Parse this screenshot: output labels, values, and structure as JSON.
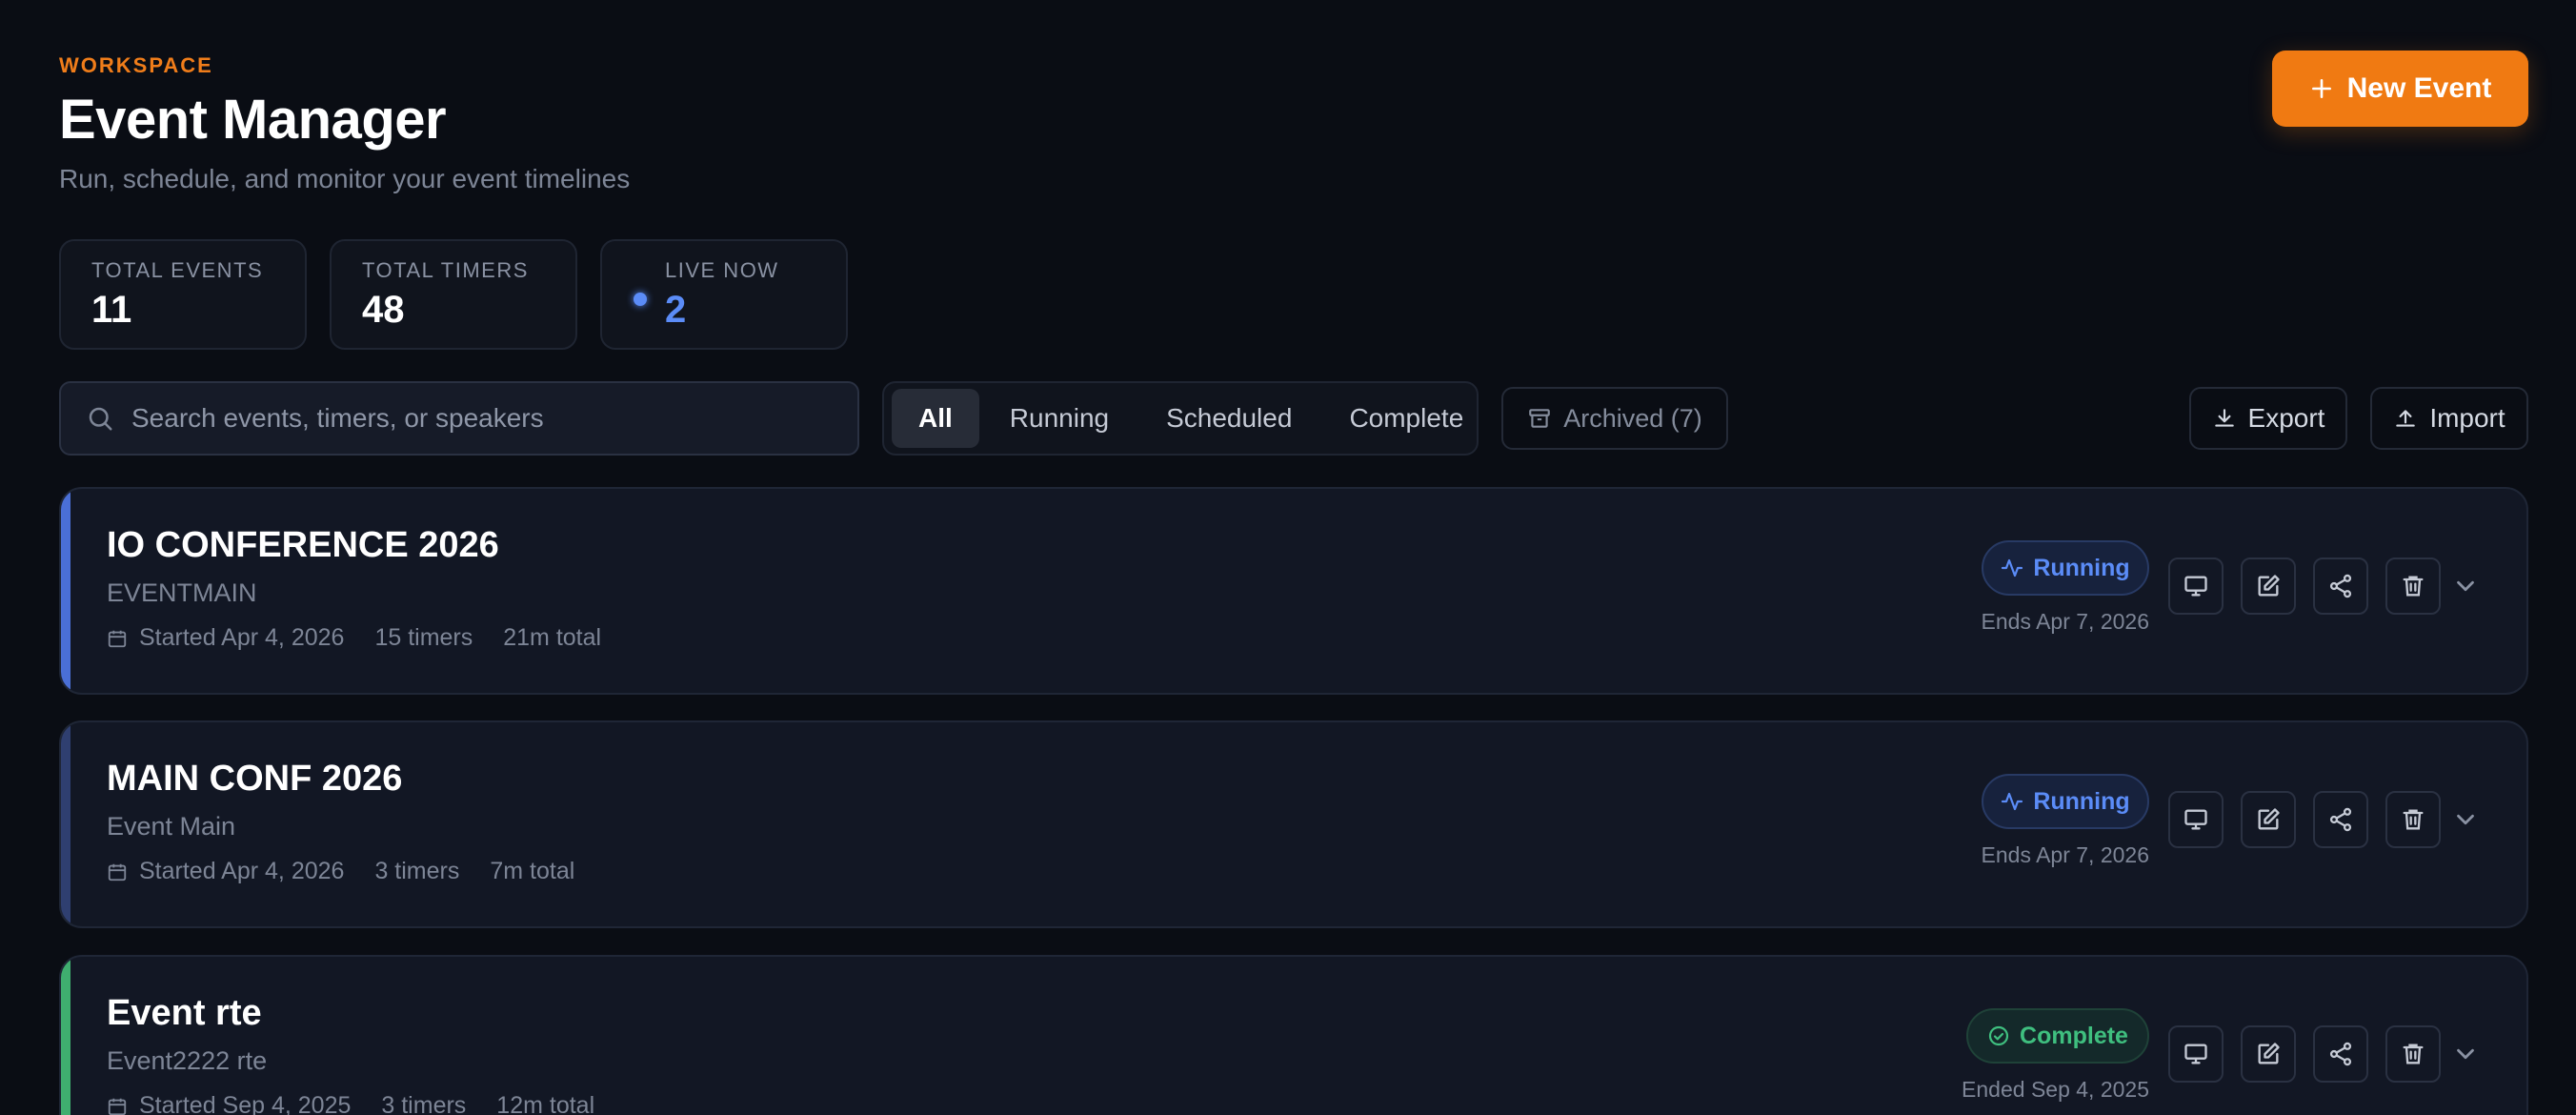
{
  "header": {
    "eyebrow": "WORKSPACE",
    "title": "Event Manager",
    "subtitle": "Run, schedule, and monitor your event timelines",
    "new_button_label": "New Event"
  },
  "stats": [
    {
      "label": "TOTAL EVENTS",
      "value": "11"
    },
    {
      "label": "TOTAL TIMERS",
      "value": "48"
    },
    {
      "label": "LIVE NOW",
      "value": "2"
    }
  ],
  "search": {
    "placeholder": "Search events, timers, or speakers",
    "value": ""
  },
  "filters": {
    "tabs": [
      "All",
      "Running",
      "Scheduled",
      "Complete"
    ],
    "active": "All",
    "archived_label": "Archived (7)"
  },
  "toolbar": {
    "export_label": "Export",
    "import_label": "Import"
  },
  "events": [
    {
      "name": "IO CONFERENCE 2026",
      "code": "EVENTMAIN",
      "started": "Started Apr 4, 2026",
      "timers": "15 timers",
      "total": "21m total",
      "status": "Running",
      "ends": "Ends Apr 7, 2026",
      "accent": "#4a6fd6"
    },
    {
      "name": "MAIN CONF 2026",
      "code": "Event Main",
      "started": "Started Apr 4, 2026",
      "timers": "3 timers",
      "total": "7m total",
      "status": "Running",
      "ends": "Ends Apr 7, 2026",
      "accent": "#2f3f70"
    },
    {
      "name": "Event rte",
      "code": "Event2222 rte",
      "started": "Started Sep 4, 2025",
      "timers": "3 timers",
      "total": "12m total",
      "status": "Complete",
      "ends": "Ended Sep 4, 2025",
      "accent": "#3fae6f"
    }
  ],
  "colors": {
    "accent": "#f07a12",
    "running": "#5b8cf7",
    "complete": "#3fbf7f",
    "background": "#0a0d14"
  },
  "icons": [
    "plus-icon",
    "search-icon",
    "archive-icon",
    "download-icon",
    "upload-icon",
    "calendar-icon",
    "activity-icon",
    "check-circle-icon",
    "monitor-icon",
    "edit-icon",
    "share-icon",
    "trash-icon",
    "chevron-down-icon"
  ]
}
